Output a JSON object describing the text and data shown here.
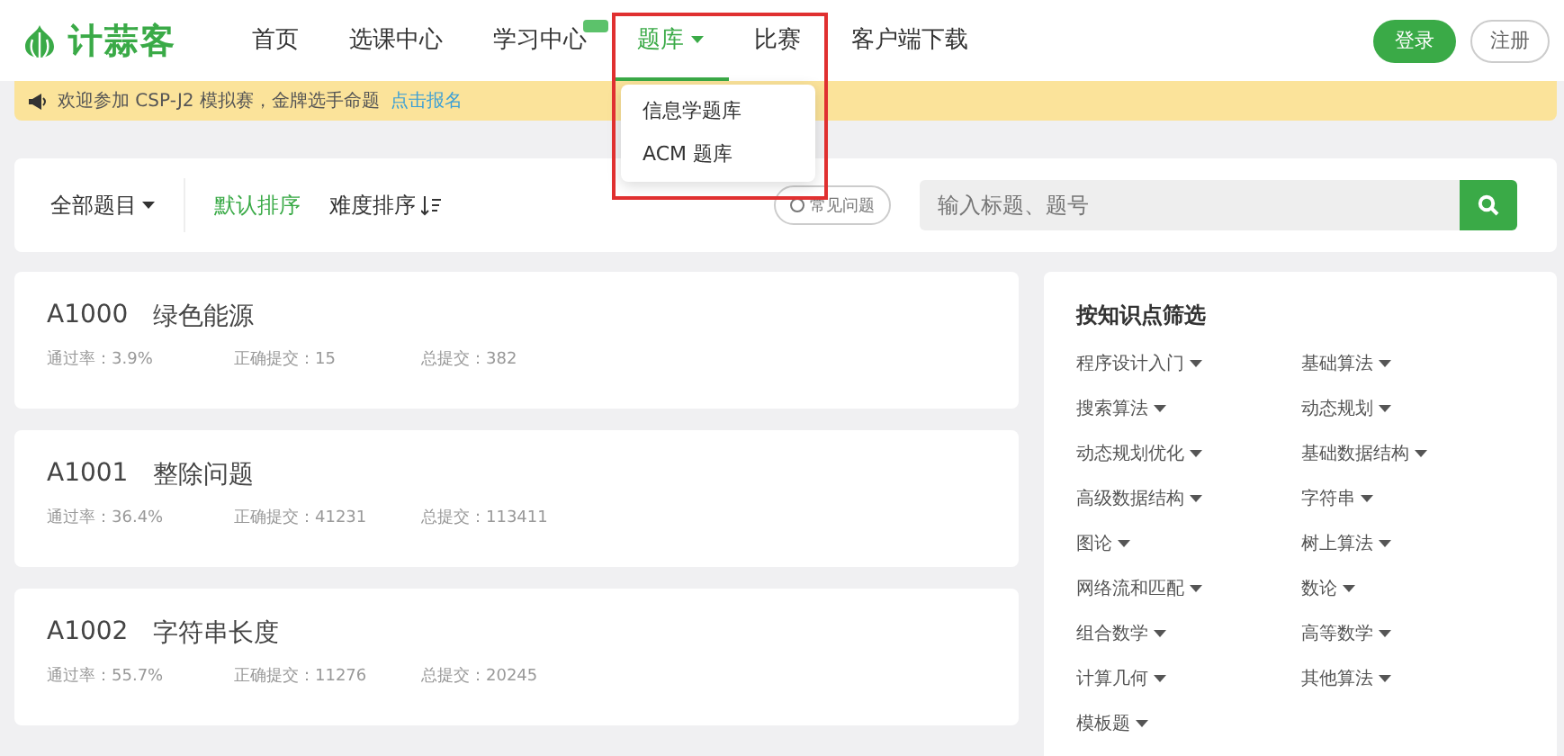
{
  "header": {
    "logo": "计蒜客",
    "nav": [
      {
        "label": "首页",
        "selected": false,
        "kind": "link",
        "badge": false
      },
      {
        "label": "选课中心",
        "selected": false,
        "kind": "link",
        "badge": false
      },
      {
        "label": "学习中心",
        "selected": false,
        "kind": "link",
        "badge": true
      },
      {
        "label": "题库",
        "selected": true,
        "kind": "dropdown",
        "badge": false
      },
      {
        "label": "比赛",
        "selected": false,
        "kind": "link",
        "badge": false
      },
      {
        "label": "客户端下载",
        "selected": false,
        "kind": "link",
        "badge": false
      }
    ],
    "dropdown": {
      "items": [
        "信息学题库",
        "ACM 题库"
      ]
    },
    "login": "登录",
    "register": "注册"
  },
  "banner": {
    "text": "欢迎参加 CSP-J2 模拟赛，金牌选手命题",
    "link": "点击报名"
  },
  "toolbar": {
    "category": "全部题目",
    "sorts": [
      {
        "label": "默认排序",
        "selected": true
      },
      {
        "label": "难度排序",
        "selected": false
      }
    ],
    "faq": "常见问题",
    "search": {
      "placeholder": "输入标题、题号"
    }
  },
  "problems": [
    {
      "id": "A1000",
      "title": "绿色能源",
      "rate": "通过率：3.9%",
      "correct": "正确提交：15",
      "total": "总提交：382"
    },
    {
      "id": "A1001",
      "title": "整除问题",
      "rate": "通过率：36.4%",
      "correct": "正确提交：41231",
      "total": "总提交：113411"
    },
    {
      "id": "A1002",
      "title": "字符串长度",
      "rate": "通过率：55.7%",
      "correct": "正确提交：11276",
      "total": "总提交：20245"
    }
  ],
  "filter": {
    "title": "按知识点筛选",
    "tags": [
      "程序设计入门",
      "基础算法",
      "搜索算法",
      "动态规划",
      "动态规划优化",
      "基础数据结构",
      "高级数据结构",
      "字符串",
      "图论",
      "树上算法",
      "网络流和匹配",
      "数论",
      "组合数学",
      "高等数学",
      "计算几何",
      "其他算法",
      "模板题"
    ]
  }
}
